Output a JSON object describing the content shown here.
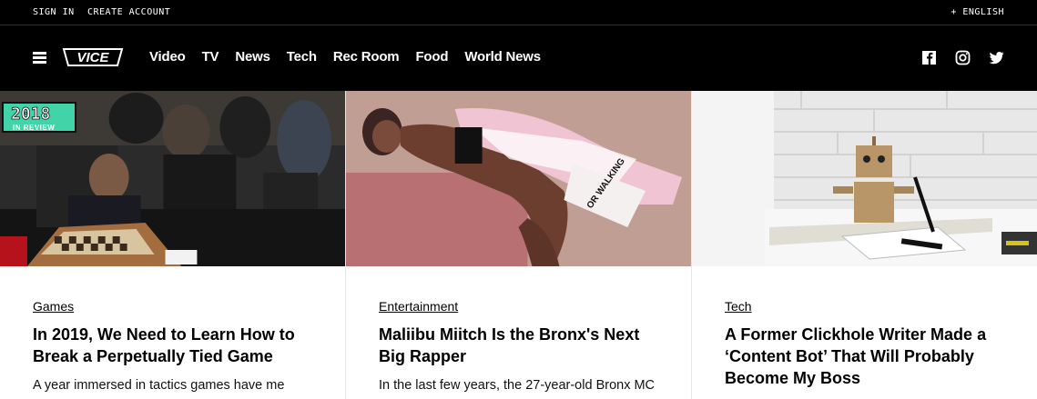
{
  "utility": {
    "sign_in": "SIGN IN",
    "create_account": "CREATE ACCOUNT",
    "language": "+ ENGLISH"
  },
  "nav": {
    "logo_text": "VICE",
    "items": [
      "Video",
      "TV",
      "News",
      "Tech",
      "Rec Room",
      "Food",
      "World News"
    ],
    "social": [
      "facebook-icon",
      "instagram-icon",
      "twitter-icon"
    ]
  },
  "cards": [
    {
      "badge_year": "2018",
      "badge_text": "IN REVIEW",
      "category": "Games",
      "headline": "In 2019, We Need to Learn How to Break a Perpetually Tied Game",
      "dek": "A year immersed in tactics games have me"
    },
    {
      "image_text": "OR WALKING",
      "category": "Entertainment",
      "headline": "Maliibu Miitch Is the Bronx's Next Big Rapper",
      "dek": "In the last few years, the 27-year-old Bronx MC"
    },
    {
      "category": "Tech",
      "headline": "A Former Clickhole Writer Made a ‘Content Bot’ That Will Probably Become My Boss"
    }
  ],
  "colors": {
    "header_bg": "#000000",
    "badge_green": "#43d3a8",
    "text": "#000000"
  }
}
